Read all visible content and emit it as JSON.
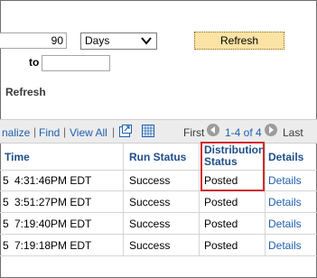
{
  "filter": {
    "interval_value": "90",
    "interval_unit": "Days",
    "refresh_button_label": "Refresh",
    "to_label": "to",
    "to_value": "",
    "refresh_link_label": "Refresh"
  },
  "toolbar": {
    "personalize_label": "nalize",
    "sep1": "|",
    "find_label": "Find",
    "sep2": "|",
    "view_all_label": "View All",
    "sep3": "|",
    "first_label": "First",
    "range_label": "1-4 of 4",
    "last_label": "Last"
  },
  "grid": {
    "headers": {
      "time": "Time",
      "run_status": "Run Status",
      "distribution_status_line1": "Distribution",
      "distribution_status_line2": "Status",
      "details": "Details"
    },
    "rows": [
      {
        "date_fragment": "5",
        "time": "4:31:46PM EDT",
        "run_status": "Success",
        "distribution_status": "Posted",
        "details": "Details"
      },
      {
        "date_fragment": "5",
        "time": "3:51:27PM EDT",
        "run_status": "Success",
        "distribution_status": "Posted",
        "details": "Details"
      },
      {
        "date_fragment": "5",
        "time": "7:19:40PM EDT",
        "run_status": "Success",
        "distribution_status": "Posted",
        "details": "Details"
      },
      {
        "date_fragment": "5",
        "time": "7:19:18PM EDT",
        "run_status": "Success",
        "distribution_status": "Posted",
        "details": "Details"
      }
    ]
  },
  "colors": {
    "highlight": "#d22a2a",
    "link": "#1f5fae",
    "header_text": "#1f4e8a",
    "button_bg": "#fbe3a5"
  }
}
